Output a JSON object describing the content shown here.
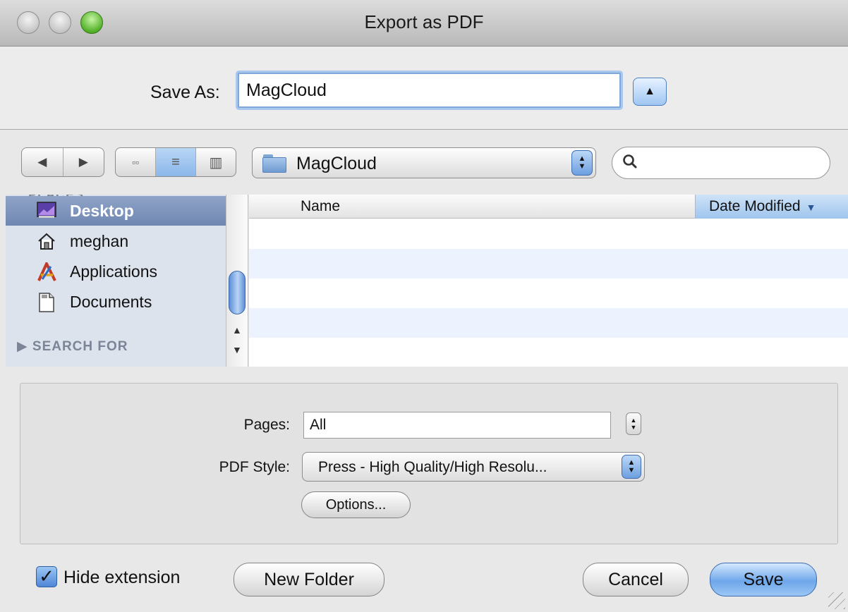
{
  "window": {
    "title": "Export as PDF"
  },
  "save_as": {
    "label": "Save As:",
    "value": "MagCloud"
  },
  "toolbar": {
    "back_icon": "◀",
    "forward_icon": "▶",
    "view_icon_icon": "▫▫",
    "view_list_icon": "≡",
    "view_column_icon": "▥",
    "location": "MagCloud",
    "search_placeholder": ""
  },
  "sidebar": {
    "cut_header": "PLACES",
    "items": [
      {
        "label": "Desktop",
        "icon": "desktop-icon",
        "selected": true
      },
      {
        "label": "meghan",
        "icon": "home-icon",
        "selected": false
      },
      {
        "label": "Applications",
        "icon": "applications-icon",
        "selected": false
      },
      {
        "label": "Documents",
        "icon": "documents-icon",
        "selected": false
      }
    ],
    "search_section": "SEARCH FOR"
  },
  "file_list": {
    "columns": {
      "name": "Name",
      "date": "Date Modified"
    },
    "rows": []
  },
  "options": {
    "pages_label": "Pages:",
    "pages_value": "All",
    "pdf_style_label": "PDF Style:",
    "pdf_style_value": "Press - High Quality/High Resolu...",
    "options_button": "Options..."
  },
  "footer": {
    "hide_extension_label": "Hide extension",
    "hide_extension_checked": true,
    "new_folder": "New Folder",
    "cancel": "Cancel",
    "save": "Save"
  },
  "colors": {
    "selection": "#7b90b8",
    "accent": "#6ea6ea",
    "sidebar_bg": "#dde3ec",
    "row_alt": "#edf3fe"
  }
}
